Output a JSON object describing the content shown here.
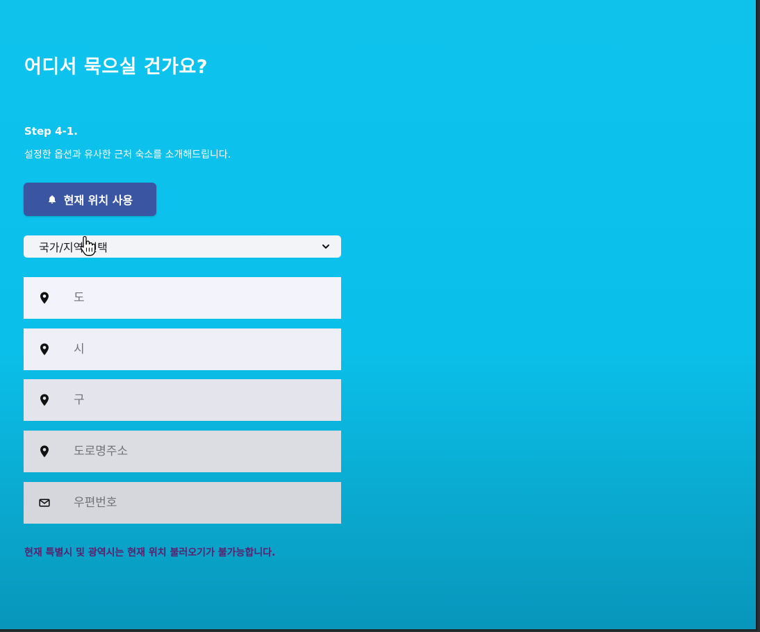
{
  "page": {
    "title": "어디서 묵으실 건가요?",
    "step_label": "Step 4-1.",
    "description": "설정한 옵션과 유사한 근처 숙소를 소개해드립니다.",
    "use_location_button": {
      "label": "현재 위치 사용",
      "icon": "bell-icon"
    },
    "country_select": {
      "selected": "국가/지역 선택",
      "icon": "chevron-down-icon"
    },
    "fields": [
      {
        "placeholder": "도",
        "icon": "map-pin-icon"
      },
      {
        "placeholder": "시",
        "icon": "map-pin-icon"
      },
      {
        "placeholder": "구",
        "icon": "map-pin-icon"
      },
      {
        "placeholder": "도로명주소",
        "icon": "map-pin-icon"
      },
      {
        "placeholder": "우편번호",
        "icon": "envelope-icon"
      }
    ],
    "notice": "현재 특별시 및 광역시는 현재 위치 불러오기가 불가능합니다."
  },
  "colors": {
    "background": "#0ec2ec",
    "button": "#3a56a3",
    "notice_text": "#5b1f6d"
  }
}
